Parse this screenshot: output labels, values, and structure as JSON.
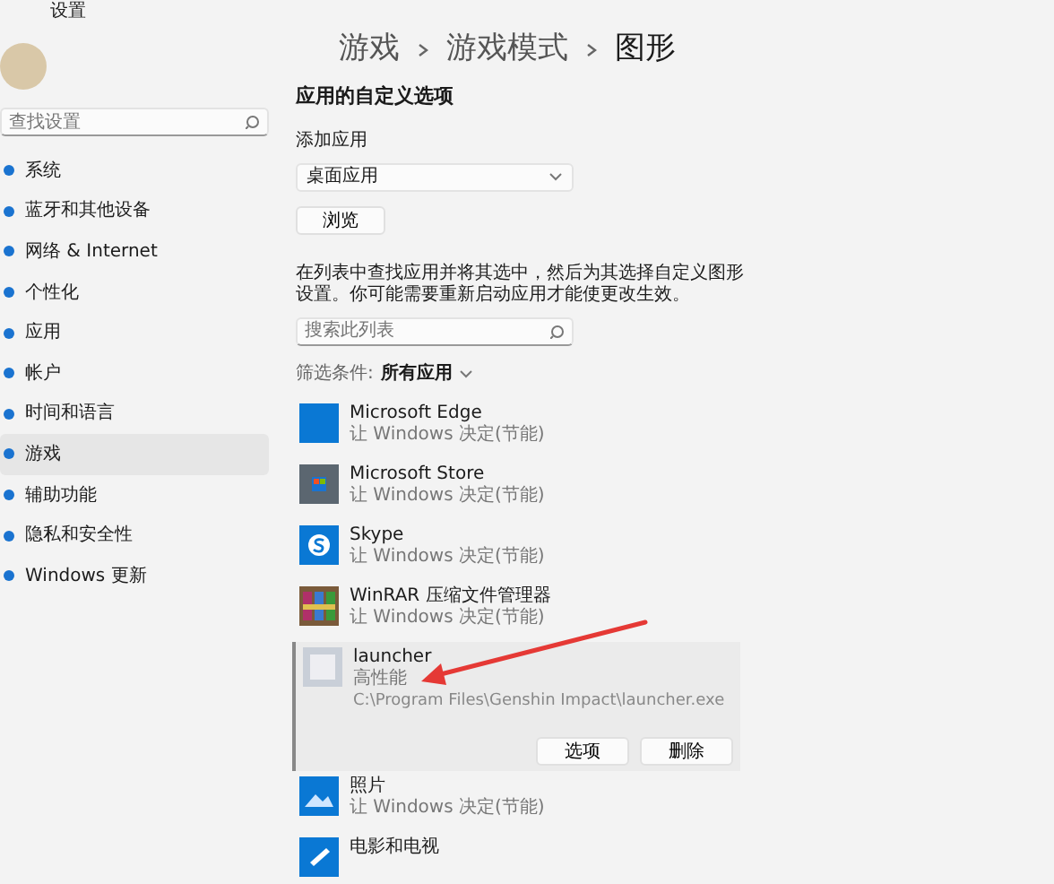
{
  "window": {
    "title": "设置"
  },
  "sidebar": {
    "search": {
      "placeholder": "查找设置"
    },
    "items": [
      {
        "label": "系统",
        "selected": false
      },
      {
        "label": "蓝牙和其他设备",
        "selected": false
      },
      {
        "label": "网络 & Internet",
        "selected": false
      },
      {
        "label": "个性化",
        "selected": false
      },
      {
        "label": "应用",
        "selected": false
      },
      {
        "label": "帐户",
        "selected": false
      },
      {
        "label": "时间和语言",
        "selected": false
      },
      {
        "label": "游戏",
        "selected": true
      },
      {
        "label": "辅助功能",
        "selected": false
      },
      {
        "label": "隐私和安全性",
        "selected": false
      },
      {
        "label": "Windows 更新",
        "selected": false
      }
    ]
  },
  "breadcrumb": [
    "游戏",
    "游戏模式",
    "图形"
  ],
  "section_title": "应用的自定义选项",
  "add_app": {
    "label": "添加应用",
    "dropdown_value": "桌面应用",
    "browse_button": "浏览"
  },
  "description": "在列表中查找应用并将其选中，然后为其选择自定义图形设置。你可能需要重新启动应用才能使更改生效。",
  "list_search": {
    "placeholder": "搜索此列表"
  },
  "filter": {
    "label": "筛选条件:",
    "value": "所有应用"
  },
  "apps": [
    {
      "kind": "edge",
      "name": "Microsoft Edge",
      "setting": "让 Windows 决定(节能)",
      "expanded": false
    },
    {
      "kind": "store",
      "name": "Microsoft Store",
      "setting": "让 Windows 决定(节能)",
      "expanded": false
    },
    {
      "kind": "skype",
      "name": "Skype",
      "setting": "让 Windows 决定(节能)",
      "expanded": false
    },
    {
      "kind": "winrar",
      "name": "WinRAR 压缩文件管理器",
      "setting": "让 Windows 决定(节能)",
      "expanded": false
    },
    {
      "kind": "game",
      "name": "launcher",
      "setting": "高性能",
      "expanded": true,
      "path": "C:\\Program Files\\Genshin Impact\\launcher.exe",
      "buttons": [
        "选项",
        "删除"
      ]
    },
    {
      "kind": "photos",
      "name": "照片",
      "setting": "让 Windows 决定(节能)",
      "expanded": false
    },
    {
      "kind": "movies",
      "name": "电影和电视",
      "expanded": false
    }
  ]
}
